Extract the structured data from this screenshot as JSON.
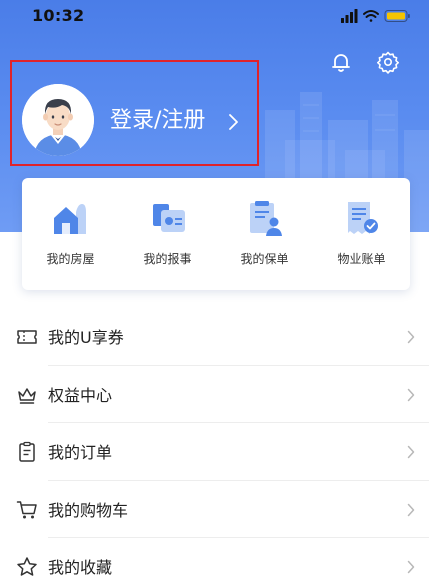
{
  "status_bar": {
    "time": "10:32",
    "battery_color": "#f5c400"
  },
  "header": {
    "notification_icon": "bell-icon",
    "settings_icon": "gear-icon",
    "login_label": "登录/注册",
    "highlight_color": "#e0232a",
    "bg_color": "#4a7de8"
  },
  "quick_actions": [
    {
      "label": "我的房屋",
      "icon": "house-icon"
    },
    {
      "label": "我的报事",
      "icon": "report-icon"
    },
    {
      "label": "我的保单",
      "icon": "policy-icon"
    },
    {
      "label": "物业账单",
      "icon": "bill-icon"
    }
  ],
  "menu": [
    {
      "label": "我的U享券",
      "icon": "coupon-icon"
    },
    {
      "label": "权益中心",
      "icon": "crown-icon"
    },
    {
      "label": "我的订单",
      "icon": "order-icon"
    },
    {
      "label": "我的购物车",
      "icon": "cart-icon"
    },
    {
      "label": "我的收藏",
      "icon": "star-icon"
    }
  ]
}
